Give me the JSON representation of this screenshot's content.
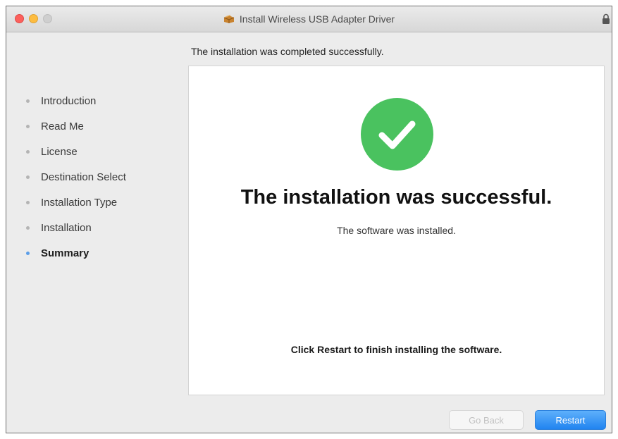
{
  "window": {
    "title": "Install Wireless USB Adapter Driver"
  },
  "header": {
    "heading": "The installation was completed successfully."
  },
  "sidebar": {
    "items": [
      {
        "label": "Introduction"
      },
      {
        "label": "Read Me"
      },
      {
        "label": "License"
      },
      {
        "label": "Destination Select"
      },
      {
        "label": "Installation Type"
      },
      {
        "label": "Installation"
      },
      {
        "label": "Summary"
      }
    ],
    "active_index": 6
  },
  "main": {
    "success_title": "The installation was successful.",
    "success_subtitle": "The software was installed.",
    "finish_note": "Click Restart to finish installing the software."
  },
  "buttons": {
    "back_label": "Go Back",
    "restart_label": "Restart"
  },
  "icons": {
    "status": "checkmark-circle-icon",
    "title": "package-icon",
    "lock": "lock-icon"
  },
  "colors": {
    "success": "#4ac25f",
    "accent": "#2184f0",
    "active_dot": "#5b9ee8"
  }
}
